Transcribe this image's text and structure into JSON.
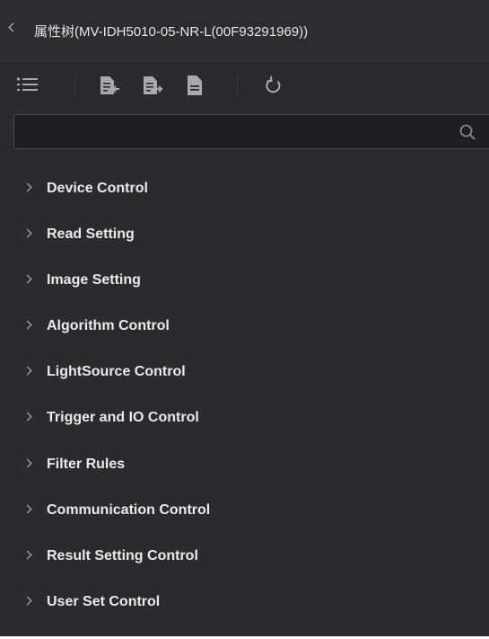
{
  "panel": {
    "title": "属性树(MV-IDH5010-05-NR-L(00F93291969))"
  },
  "toolbar": {
    "icons": [
      "expand-collapse-icon",
      "import-file-icon",
      "export-file-icon",
      "document-icon",
      "refresh-icon"
    ]
  },
  "search": {
    "value": "",
    "placeholder": ""
  },
  "tree": {
    "items": [
      {
        "label": "Device Control"
      },
      {
        "label": "Read Setting"
      },
      {
        "label": "Image Setting"
      },
      {
        "label": "Algorithm Control"
      },
      {
        "label": "LightSource Control"
      },
      {
        "label": "Trigger and IO Control"
      },
      {
        "label": "Filter Rules"
      },
      {
        "label": "Communication Control"
      },
      {
        "label": "Result Setting Control"
      },
      {
        "label": "User Set Control"
      }
    ]
  },
  "colors": {
    "panel_bg": "#2b2b2d",
    "search_bg": "#1f1f21",
    "icon": "#a9a9ad",
    "text": "#eaeaea"
  }
}
